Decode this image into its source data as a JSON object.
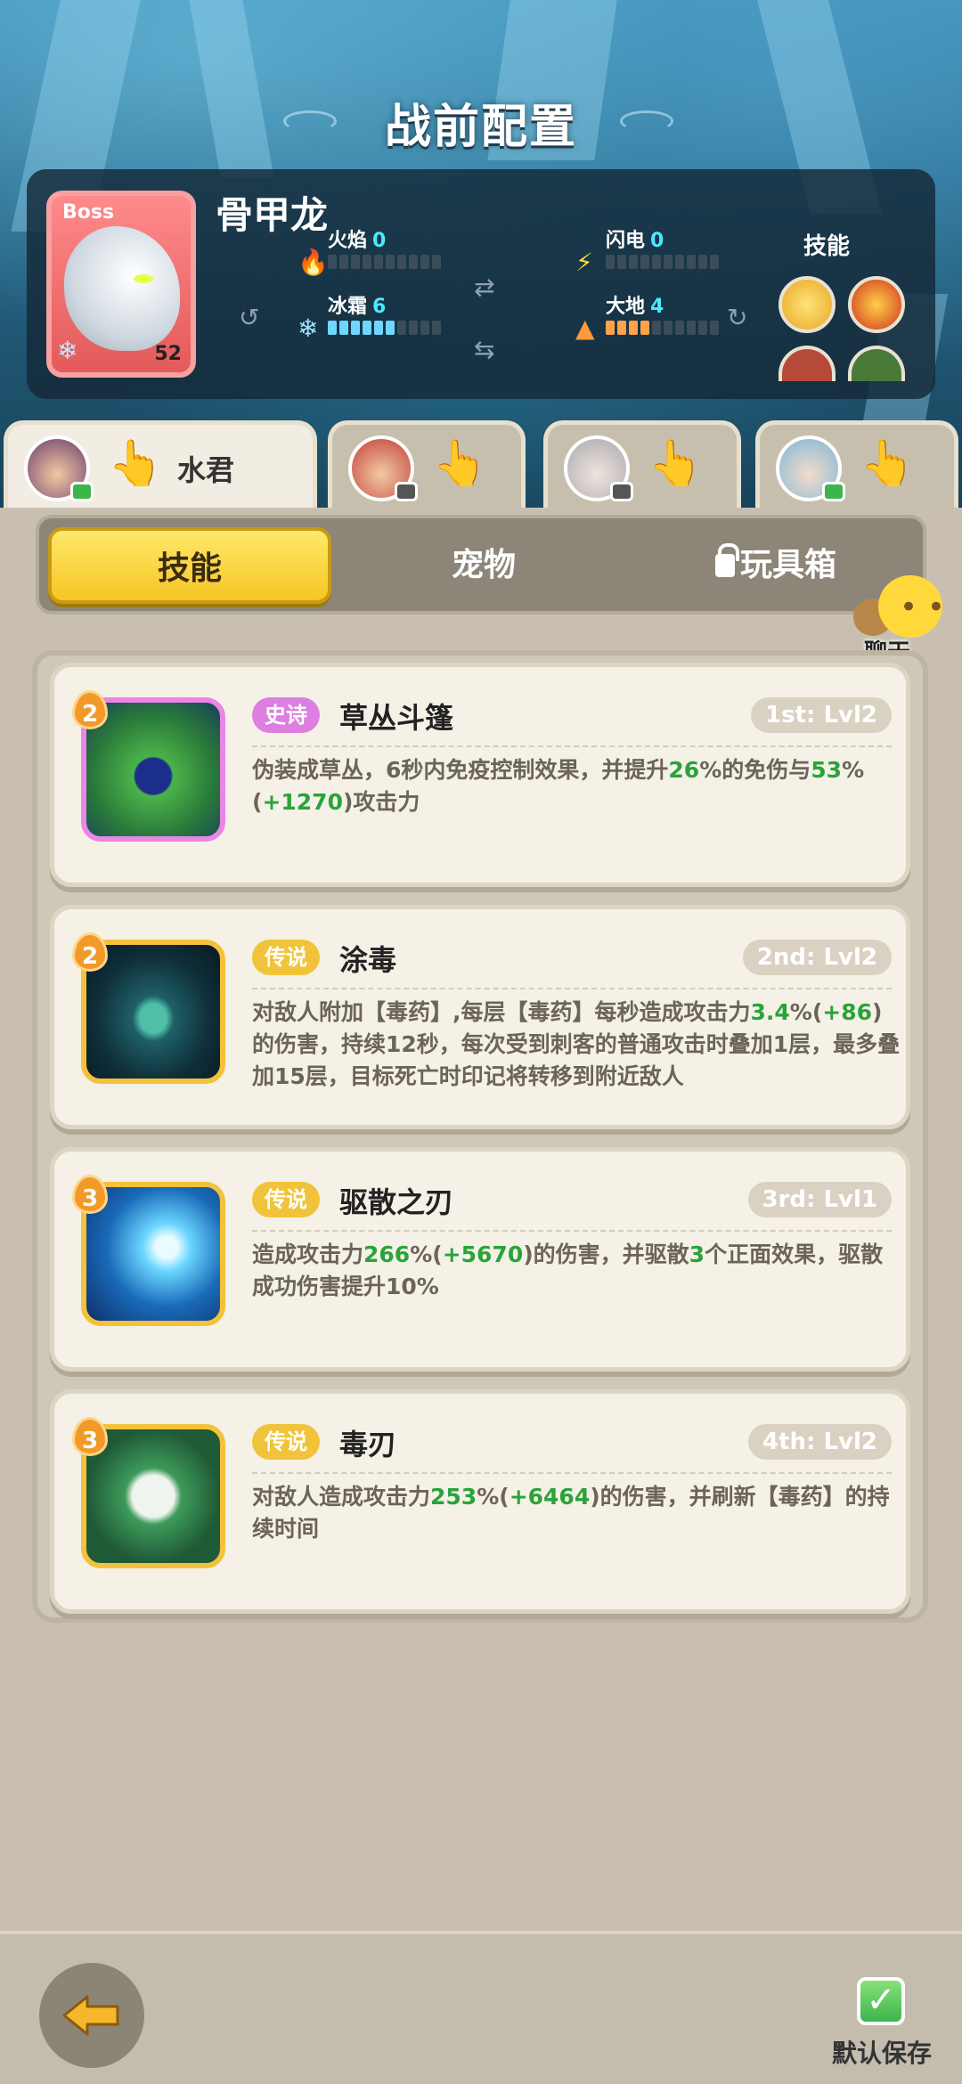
{
  "page": {
    "title": "战前配置"
  },
  "boss": {
    "tag": "Boss",
    "name": "骨甲龙",
    "level": "52",
    "stats": [
      {
        "label": "火焰",
        "value": "0",
        "filled": 0,
        "icon": "fire-icon"
      },
      {
        "label": "闪电",
        "value": "0",
        "filled": 0,
        "icon": "lightning-icon"
      },
      {
        "label": "冰霜",
        "value": "6",
        "filled": 6,
        "icon": "frost-icon"
      },
      {
        "label": "大地",
        "value": "4",
        "filled": 4,
        "icon": "earth-icon"
      }
    ],
    "skills_label": "技能"
  },
  "heroes": [
    {
      "name": "水君",
      "active": true
    },
    {
      "name": "",
      "active": false
    },
    {
      "name": "",
      "active": false
    },
    {
      "name": "",
      "active": false
    }
  ],
  "categories": {
    "skills": "技能",
    "pets": "宠物",
    "toybox": "玩具箱"
  },
  "chat": {
    "label": "聊天"
  },
  "skills": [
    {
      "cost": "2",
      "rarity": "史诗",
      "name": "草丛斗篷",
      "level": "1st: Lvl2",
      "desc": [
        {
          "t": "伪装成草丛，6秒内免疫控制效果，并提升"
        },
        {
          "t": "26",
          "g": true
        },
        {
          "t": "%的免伤与"
        },
        {
          "t": "53",
          "g": true
        },
        {
          "t": "%("
        },
        {
          "t": "+1270",
          "g": true
        },
        {
          "t": ")攻击力"
        }
      ]
    },
    {
      "cost": "2",
      "rarity": "传说",
      "name": "涂毒",
      "level": "2nd: Lvl2",
      "desc": [
        {
          "t": "对敌人附加【毒药】,每层【毒药】每秒造成攻击力"
        },
        {
          "t": "3.4",
          "g": true
        },
        {
          "t": "%("
        },
        {
          "t": "+86",
          "g": true
        },
        {
          "t": ")的伤害，持续12秒，每次受到刺客的普通攻击时叠加1层，最多叠加15层，目标死亡时印记将转移到附近敌人"
        }
      ]
    },
    {
      "cost": "3",
      "rarity": "传说",
      "name": "驱散之刃",
      "level": "3rd: Lvl1",
      "desc": [
        {
          "t": "造成攻击力"
        },
        {
          "t": "266",
          "g": true
        },
        {
          "t": "%("
        },
        {
          "t": "+5670",
          "g": true
        },
        {
          "t": ")的伤害，并驱散"
        },
        {
          "t": "3",
          "g": true
        },
        {
          "t": "个正面效果，驱散成功伤害提升10%"
        }
      ]
    },
    {
      "cost": "3",
      "rarity": "传说",
      "name": "毒刃",
      "level": "4th: Lvl2",
      "desc": [
        {
          "t": "对敌人造成攻击力"
        },
        {
          "t": "253",
          "g": true
        },
        {
          "t": "%("
        },
        {
          "t": "+6464",
          "g": true
        },
        {
          "t": ")的伤害，并刷新【毒药】的持续时间"
        }
      ]
    }
  ],
  "footer": {
    "save_label": "默认保存"
  },
  "colors": {
    "gold": "#f5c623",
    "epic": "#dc7fe0",
    "legend": "#f0c33a",
    "highlight": "#2aa33a",
    "stat_value": "#4be8ff"
  }
}
